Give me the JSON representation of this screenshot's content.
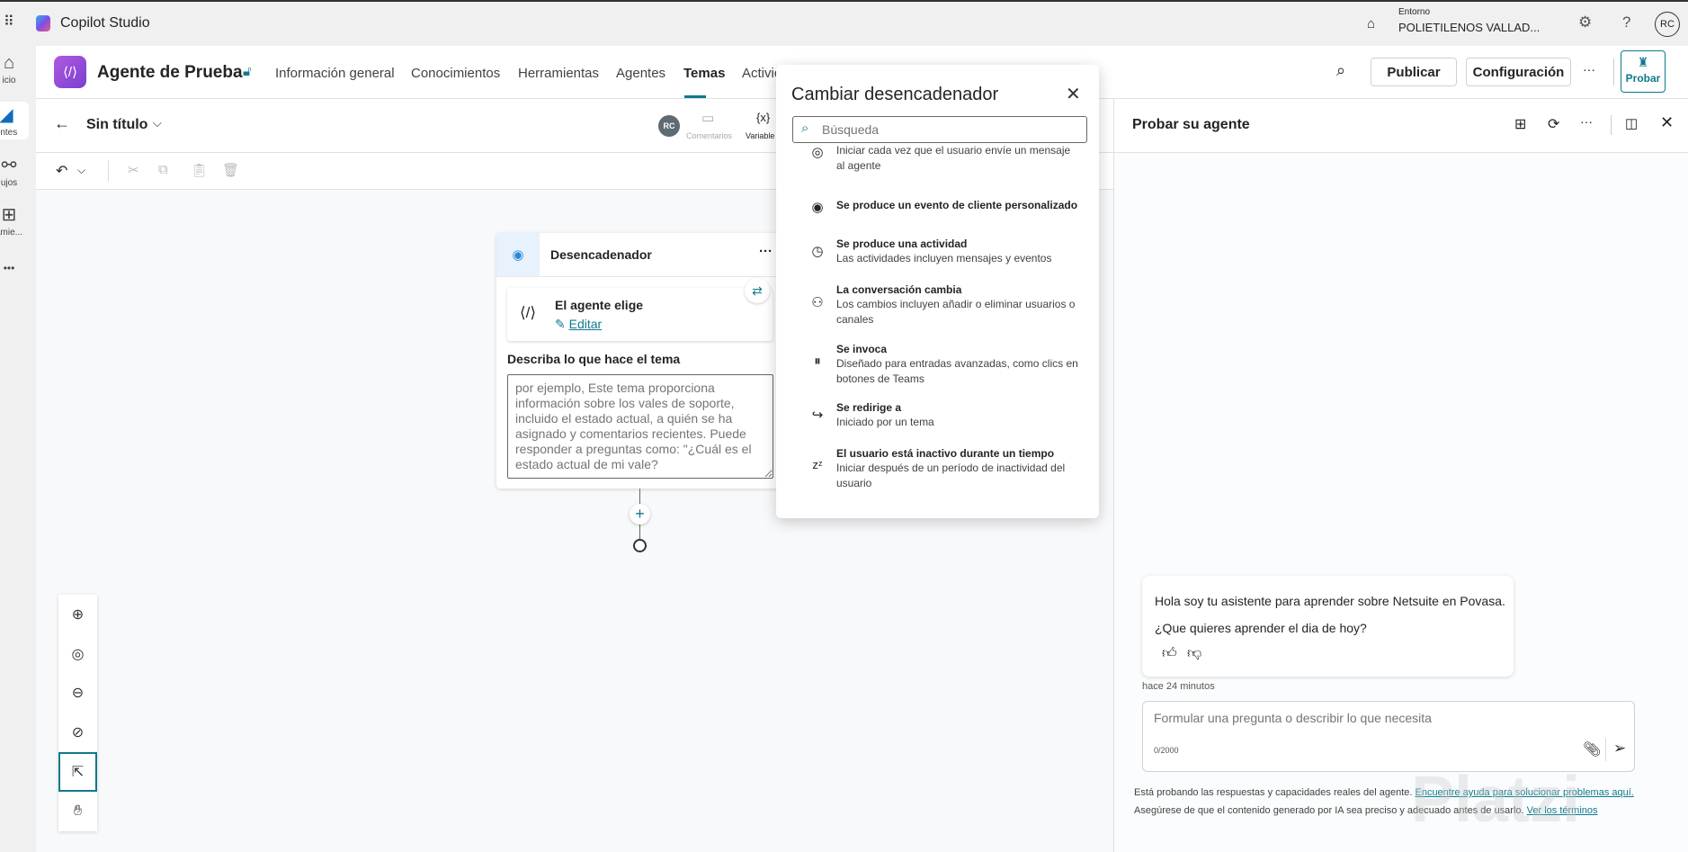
{
  "app": {
    "title": "Copilot Studio",
    "env_label": "Entorno",
    "env_value": "POLIETILENOS VALLAD...",
    "avatar": "RC"
  },
  "rail": [
    {
      "label": "icio",
      "icon": "home-icon"
    },
    {
      "label": "entes",
      "icon": "agents-icon"
    },
    {
      "label": "ujos",
      "icon": "flows-icon"
    },
    {
      "label": "amie...",
      "icon": "tools-icon"
    },
    {
      "label": "•••",
      "icon": "more-icon"
    }
  ],
  "agent": {
    "name": "Agente de Prueba",
    "tabs": [
      "Información general",
      "Conocimientos",
      "Herramientas",
      "Agentes",
      "Temas",
      "Activic"
    ],
    "active_tab": "Temas",
    "publish": "Publicar",
    "settings": "Configuración",
    "more": "···",
    "test": "Probar"
  },
  "topic": {
    "title": "Sin título",
    "avatar": "RC",
    "comments": "Comentarios",
    "variables": "Variable",
    "var_glyph": "{x}"
  },
  "trigger": {
    "title": "Desencadenador",
    "more": "···",
    "mode": "El agente elige",
    "edit": "Editar",
    "desc_label": "Describa lo que hace el tema",
    "desc_placeholder": "por ejemplo, Este tema proporciona información sobre los vales de soporte, incluido el estado actual, a quién se ha asignado y comentarios recientes. Puede responder a preguntas como: \"¿Cuál es el estado actual de mi vale?"
  },
  "popup": {
    "title": "Cambiar desencadenador",
    "search_placeholder": "Búsqueda",
    "options": [
      {
        "title": "",
        "desc": "Iniciar cada vez que el usuario envíe un mensaje al agente",
        "icon": "target-icon"
      },
      {
        "title": "Se produce un evento de cliente personalizado",
        "desc": "",
        "icon": "broadcast-icon"
      },
      {
        "title": "Se produce una actividad",
        "desc": "Las actividades incluyen mensajes y eventos",
        "icon": "clock-icon"
      },
      {
        "title": "La conversación cambia",
        "desc": "Los cambios incluyen añadir o eliminar usuarios o canales",
        "icon": "person-change-icon"
      },
      {
        "title": "Se invoca",
        "desc": "Diseñado para entradas avanzadas, como clics en botones de Teams",
        "icon": "pause-circle-icon"
      },
      {
        "title": "Se redirige a",
        "desc": "Iniciado por un tema",
        "icon": "redirect-icon"
      },
      {
        "title": "El usuario está inactivo durante un tiempo",
        "desc": "Iniciar después de un período de inactividad del usuario",
        "icon": "sleep-icon"
      }
    ]
  },
  "test_panel": {
    "title": "Probar su agente",
    "msg1": "Hola soy tu asistente para aprender sobre Netsuite en Povasa.",
    "msg2": "¿Que quieres aprender el dia de hoy?",
    "time": "hace 24 minutos",
    "input_placeholder": "Formular una pregunta o describir lo que necesita",
    "counter": "0/2000",
    "disc_1": "Está probando las respuestas y capacidades reales del agente. ",
    "disc_link1": "Encuentre ayuda para solucionar problemas aquí.",
    "disc_2": " Asegúrese de que el contenido generado por IA sea preciso y adecuado antes de usarlo. ",
    "disc_link2": "Ver los términos"
  },
  "watermark": "Platzi",
  "colors": {
    "accent": "#0f6cbd",
    "teal": "#0e7a8b",
    "agent_icon": "#8a4ad8"
  }
}
